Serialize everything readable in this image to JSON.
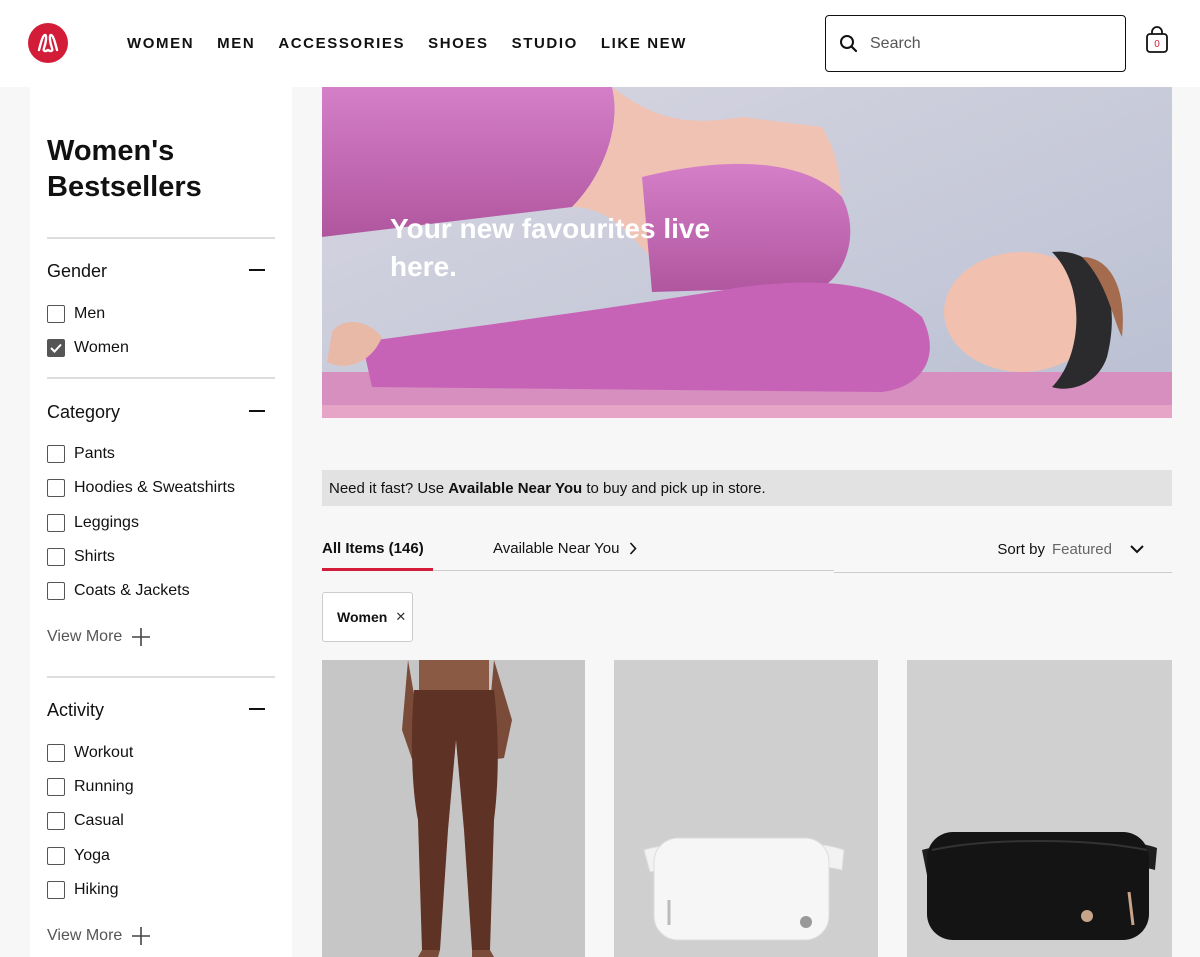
{
  "colors": {
    "brand_red": "#d31c38",
    "hero_pink": "#c866b8",
    "legging_brown": "#5e3224"
  },
  "header": {
    "logo_icon": "lululemon-logo-icon",
    "nav": [
      "WOMEN",
      "MEN",
      "ACCESSORIES",
      "SHOES",
      "STUDIO",
      "LIKE NEW"
    ],
    "search_placeholder": "Search",
    "bag_count": "0"
  },
  "sidebar": {
    "title": "Women's Bestsellers",
    "facets": [
      {
        "title": "Gender",
        "options": [
          {
            "label": "Men",
            "checked": false
          },
          {
            "label": "Women",
            "checked": true
          }
        ]
      },
      {
        "title": "Category",
        "options": [
          {
            "label": "Pants",
            "checked": false
          },
          {
            "label": "Hoodies & Sweatshirts",
            "checked": false
          },
          {
            "label": "Leggings",
            "checked": false
          },
          {
            "label": "Shirts",
            "checked": false
          },
          {
            "label": "Coats & Jackets",
            "checked": false
          }
        ],
        "view_more": "View More"
      },
      {
        "title": "Activity",
        "options": [
          {
            "label": "Workout",
            "checked": false
          },
          {
            "label": "Running",
            "checked": false
          },
          {
            "label": "Casual",
            "checked": false
          },
          {
            "label": "Yoga",
            "checked": false
          },
          {
            "label": "Hiking",
            "checked": false
          }
        ],
        "view_more": "View More"
      }
    ]
  },
  "hero": {
    "headline": "Your new favourites live here."
  },
  "notice": {
    "prefix": "Need it fast? Use ",
    "bold": "Available Near You",
    "suffix": " to buy and pick up in store."
  },
  "tabs": {
    "all_items": "All Items (146)",
    "near_you": "Available Near You"
  },
  "sort": {
    "label": "Sort by",
    "value": "Featured"
  },
  "active_filter": {
    "label": "Women"
  },
  "products": [
    {
      "image": "brown-leggings-image"
    },
    {
      "image": "white-belt-bag-image"
    },
    {
      "image": "black-belt-bag-image"
    }
  ]
}
